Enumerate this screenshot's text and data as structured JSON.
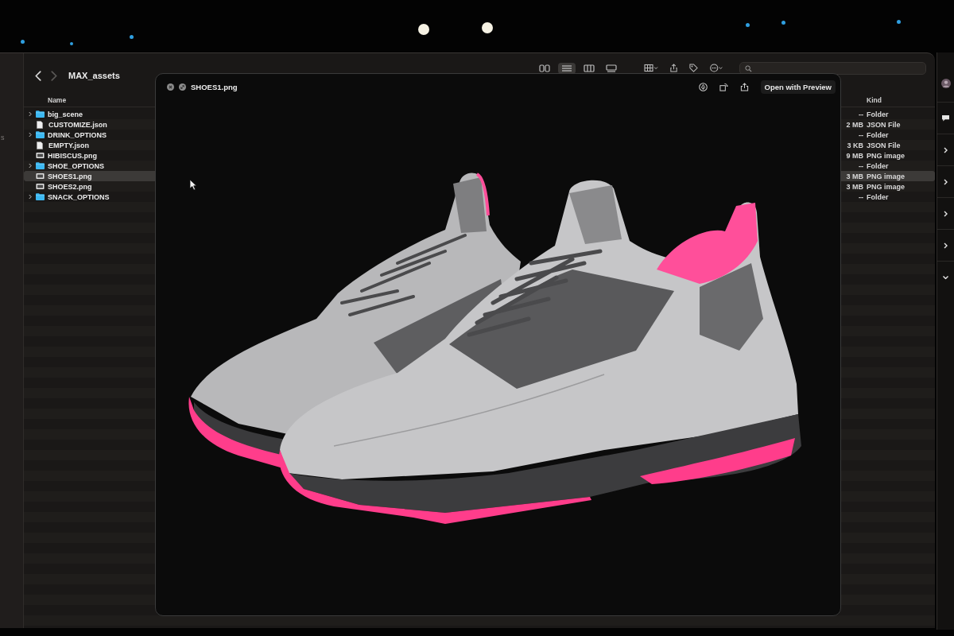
{
  "stage": {
    "lights": [
      {
        "color": "#2f9fe0"
      },
      {
        "color": "#2f9fe0"
      },
      {
        "color": "#2f9fe0"
      },
      {
        "color": "#f6f2e4"
      },
      {
        "color": "#f6f2e4"
      },
      {
        "color": "#2f9fe0"
      },
      {
        "color": "#2f9fe0"
      },
      {
        "color": "#2f9fe0"
      }
    ]
  },
  "finder": {
    "sidebar_items": [
      "s"
    ],
    "back": {
      "disabled": false
    },
    "forward": {
      "disabled": true
    },
    "title": "MAX_assets",
    "view_modes": [
      {
        "kind": "icons",
        "selected": false
      },
      {
        "kind": "list",
        "selected": true
      },
      {
        "kind": "columns",
        "selected": false
      },
      {
        "kind": "gallery",
        "selected": false
      }
    ],
    "columns": {
      "name": "Name",
      "kind": "Kind"
    },
    "files": [
      {
        "name": "big_scene",
        "kind": "folder",
        "expanded": false,
        "size": "--",
        "file_kind": "Folder",
        "selected": false
      },
      {
        "name": "CUSTOMIZE.json",
        "kind": "document",
        "size": "2 MB",
        "file_kind": "JSON File",
        "selected": false
      },
      {
        "name": "DRINK_OPTIONS",
        "kind": "folder",
        "expanded": false,
        "size": "--",
        "file_kind": "Folder",
        "selected": false
      },
      {
        "name": "EMPTY.json",
        "kind": "document",
        "size": "3 KB",
        "file_kind": "JSON File",
        "selected": false
      },
      {
        "name": "HIBISCUS.png",
        "kind": "image",
        "size": "9 MB",
        "file_kind": "PNG image",
        "selected": false
      },
      {
        "name": "SHOE_OPTIONS",
        "kind": "folder",
        "expanded": false,
        "size": "--",
        "file_kind": "Folder",
        "selected": false
      },
      {
        "name": "SHOES1.png",
        "kind": "image",
        "size": "3 MB",
        "file_kind": "PNG image",
        "selected": true
      },
      {
        "name": "SHOES2.png",
        "kind": "image",
        "size": "3 MB",
        "file_kind": "PNG image",
        "selected": false
      },
      {
        "name": "SNACK_OPTIONS",
        "kind": "folder",
        "expanded": false,
        "size": "--",
        "file_kind": "Folder",
        "selected": false
      }
    ]
  },
  "quick_look": {
    "title": "SHOES1.png",
    "open_button": "Open with Preview"
  },
  "inspector": {
    "sections": [
      {
        "expanded": false
      },
      {
        "expanded": false
      },
      {
        "expanded": false
      },
      {
        "expanded": false
      },
      {
        "expanded": true
      }
    ]
  }
}
